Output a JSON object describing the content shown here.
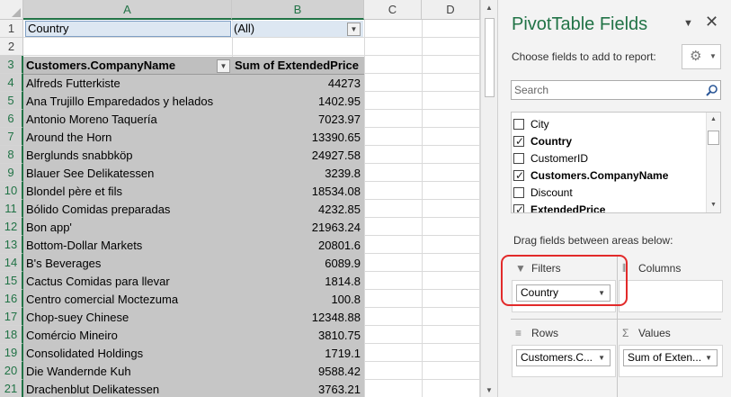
{
  "sheet": {
    "columns": [
      "A",
      "B",
      "C",
      "D"
    ],
    "row_numbers": [
      1,
      2,
      3,
      4,
      5,
      6,
      7,
      8,
      9,
      10,
      11,
      12,
      13,
      14,
      15,
      16,
      17,
      18,
      19,
      20,
      21
    ],
    "filter_label": "Country",
    "filter_value": "(All)",
    "headers": {
      "company": "Customers.CompanyName",
      "sum": "Sum of ExtendedPrice"
    },
    "rows": [
      {
        "company": "Alfreds Futterkiste",
        "value": "44273"
      },
      {
        "company": "Ana Trujillo Emparedados y helados",
        "value": "1402.95"
      },
      {
        "company": "Antonio Moreno Taquería",
        "value": "7023.97"
      },
      {
        "company": "Around the Horn",
        "value": "13390.65"
      },
      {
        "company": "Berglunds snabbköp",
        "value": "24927.58"
      },
      {
        "company": "Blauer See Delikatessen",
        "value": "3239.8"
      },
      {
        "company": "Blondel père et fils",
        "value": "18534.08"
      },
      {
        "company": "Bólido Comidas preparadas",
        "value": "4232.85"
      },
      {
        "company": "Bon app'",
        "value": "21963.24"
      },
      {
        "company": "Bottom-Dollar Markets",
        "value": "20801.6"
      },
      {
        "company": "B's Beverages",
        "value": "6089.9"
      },
      {
        "company": "Cactus Comidas para llevar",
        "value": "1814.8"
      },
      {
        "company": "Centro comercial Moctezuma",
        "value": "100.8"
      },
      {
        "company": "Chop-suey Chinese",
        "value": "12348.88"
      },
      {
        "company": "Comércio Mineiro",
        "value": "3810.75"
      },
      {
        "company": "Consolidated Holdings",
        "value": "1719.1"
      },
      {
        "company": "Die Wandernde Kuh",
        "value": "9588.42"
      },
      {
        "company": "Drachenblut Delikatessen",
        "value": "3763.21"
      }
    ]
  },
  "pane": {
    "title": "PivotTable Fields",
    "choose_label": "Choose fields to add to report:",
    "search_placeholder": "Search",
    "fields": [
      {
        "label": "City",
        "checked": false
      },
      {
        "label": "Country",
        "checked": true
      },
      {
        "label": "CustomerID",
        "checked": false
      },
      {
        "label": "Customers.CompanyName",
        "checked": true
      },
      {
        "label": "Discount",
        "checked": false
      },
      {
        "label": "ExtendedPrice",
        "checked": true
      }
    ],
    "drag_label": "Drag fields between areas below:",
    "areas": {
      "filters": {
        "label": "Filters",
        "items": [
          "Country"
        ]
      },
      "columns": {
        "label": "Columns",
        "items": []
      },
      "rows": {
        "label": "Rows",
        "items": [
          "Customers.C..."
        ]
      },
      "values": {
        "label": "Values",
        "items": [
          "Sum of Exten..."
        ]
      }
    },
    "colors": {
      "accent": "#217346",
      "highlight": "#e22a2a"
    }
  }
}
